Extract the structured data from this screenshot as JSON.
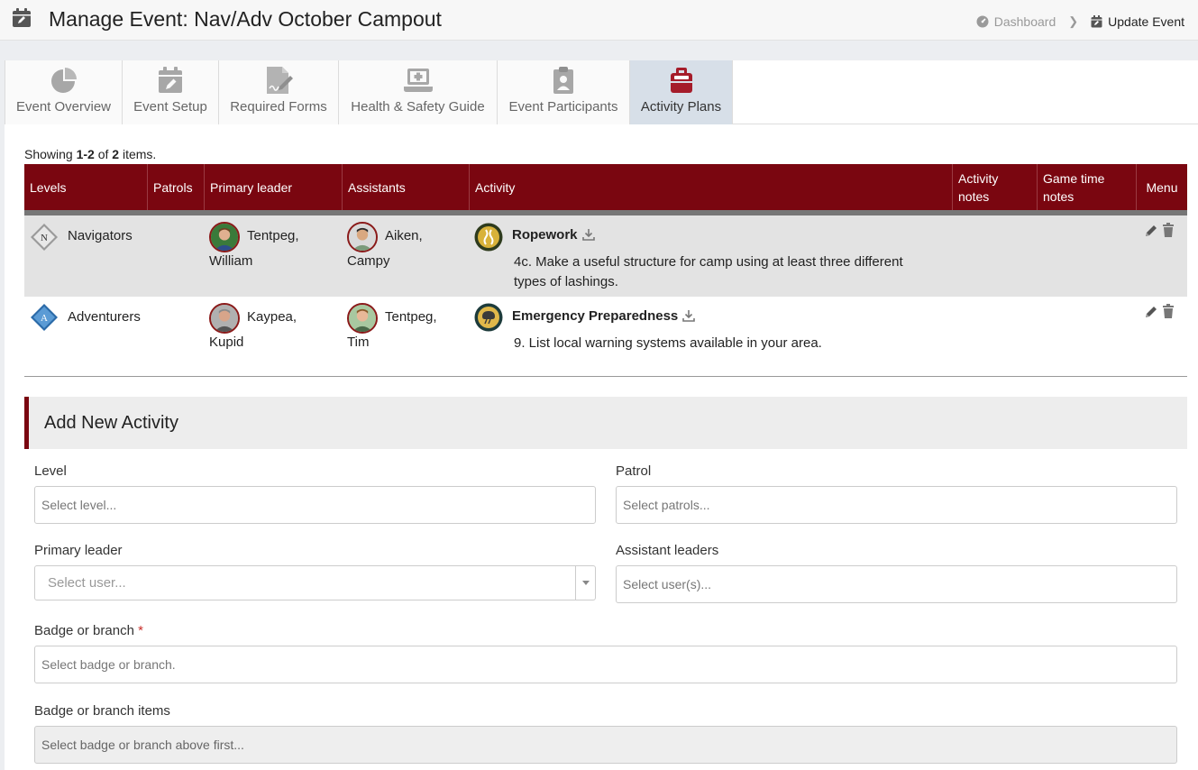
{
  "header": {
    "title": "Manage Event: Nav/Adv October Campout",
    "breadcrumbs": [
      {
        "label": "Dashboard"
      },
      {
        "label": "Update Event"
      }
    ]
  },
  "tabs": [
    {
      "label": "Event Overview",
      "icon": "pie-chart-icon",
      "active": false
    },
    {
      "label": "Event Setup",
      "icon": "calendar-edit-icon",
      "active": false
    },
    {
      "label": "Required Forms",
      "icon": "signed-document-icon",
      "active": false
    },
    {
      "label": "Health & Safety Guide",
      "icon": "laptop-medical-icon",
      "active": false
    },
    {
      "label": "Event Participants",
      "icon": "clipboard-user-icon",
      "active": false
    },
    {
      "label": "Activity Plans",
      "icon": "first-aid-bag-icon",
      "active": true
    }
  ],
  "summary": {
    "prefix": "Showing ",
    "range": "1-2",
    "of": " of ",
    "total": "2",
    "suffix": " items."
  },
  "table": {
    "columns": {
      "levels": "Levels",
      "patrols": "Patrols",
      "primary_leader": "Primary leader",
      "assistants": "Assistants",
      "activity": "Activity",
      "activity_notes_1": "Activity",
      "activity_notes_2": "notes",
      "game_time_1": "Game time",
      "game_time_2": "notes",
      "menu": "Menu"
    },
    "rows": [
      {
        "level": "Navigators",
        "patrols": "",
        "leader_1": "Tentpeg,",
        "leader_2": "William",
        "assistant_1": "Aiken,",
        "assistant_2": "Campy",
        "activity_title": "Ropework",
        "activity_desc_1": "4c. Make a useful structure for camp using at least three different",
        "activity_desc_2": "types of lashings.",
        "activity_notes": "",
        "game_time_notes": ""
      },
      {
        "level": "Adventurers",
        "patrols": "",
        "leader_1": "Kaypea,",
        "leader_2": "Kupid",
        "assistant_1": "Tentpeg,",
        "assistant_2": "Tim",
        "activity_title": "Emergency Preparedness",
        "activity_desc_1": "9. List local warning systems available in your area.",
        "activity_notes": "",
        "game_time_notes": ""
      }
    ]
  },
  "form": {
    "title": "Add New Activity",
    "level_label": "Level",
    "level_placeholder": "Select level...",
    "patrol_label": "Patrol",
    "patrol_placeholder": "Select patrols...",
    "primary_label": "Primary leader",
    "primary_placeholder": "Select user...",
    "assistant_label": "Assistant leaders",
    "assistant_placeholder": "Select user(s)...",
    "badge_label": "Badge or branch",
    "badge_required": "*",
    "badge_placeholder": "Select badge or branch.",
    "items_label": "Badge or branch items",
    "items_placeholder": "Select badge or branch above first..."
  },
  "colors": {
    "accent": "#7a0610",
    "active_tab": "#d7dfe8",
    "row_alt": "#e3e3e3"
  }
}
